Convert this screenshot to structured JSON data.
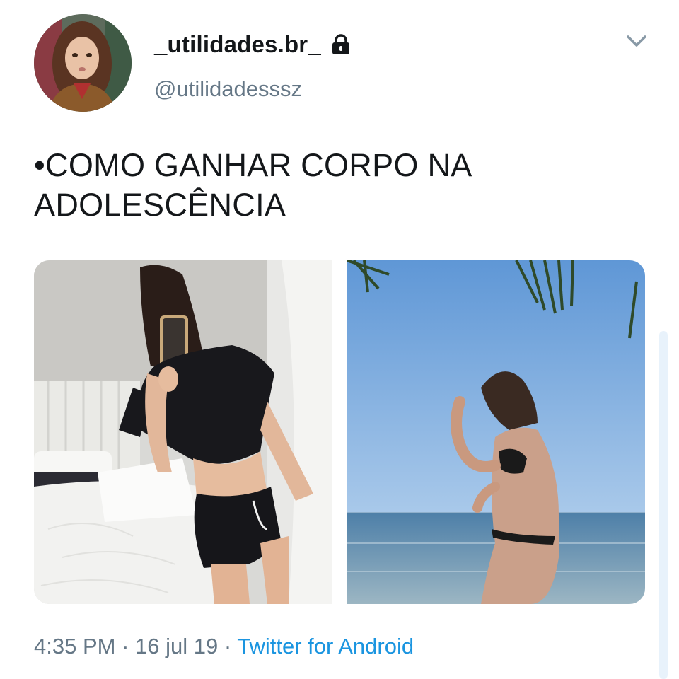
{
  "tweet": {
    "display_name": "_utilidades.br_",
    "handle": "@utilidadesssz",
    "protected_icon": "lock-icon",
    "more_icon": "chevron-down-icon",
    "text_line1": "•COMO GANHAR CORPO NA",
    "text_line2": "ADOLESCÊNCIA",
    "time": "4:35 PM",
    "separator": " · ",
    "date": "16 jul 19",
    "source": "Twitter for Android"
  },
  "colors": {
    "text": "#14171a",
    "secondary": "#657786",
    "link": "#1b95e0"
  }
}
